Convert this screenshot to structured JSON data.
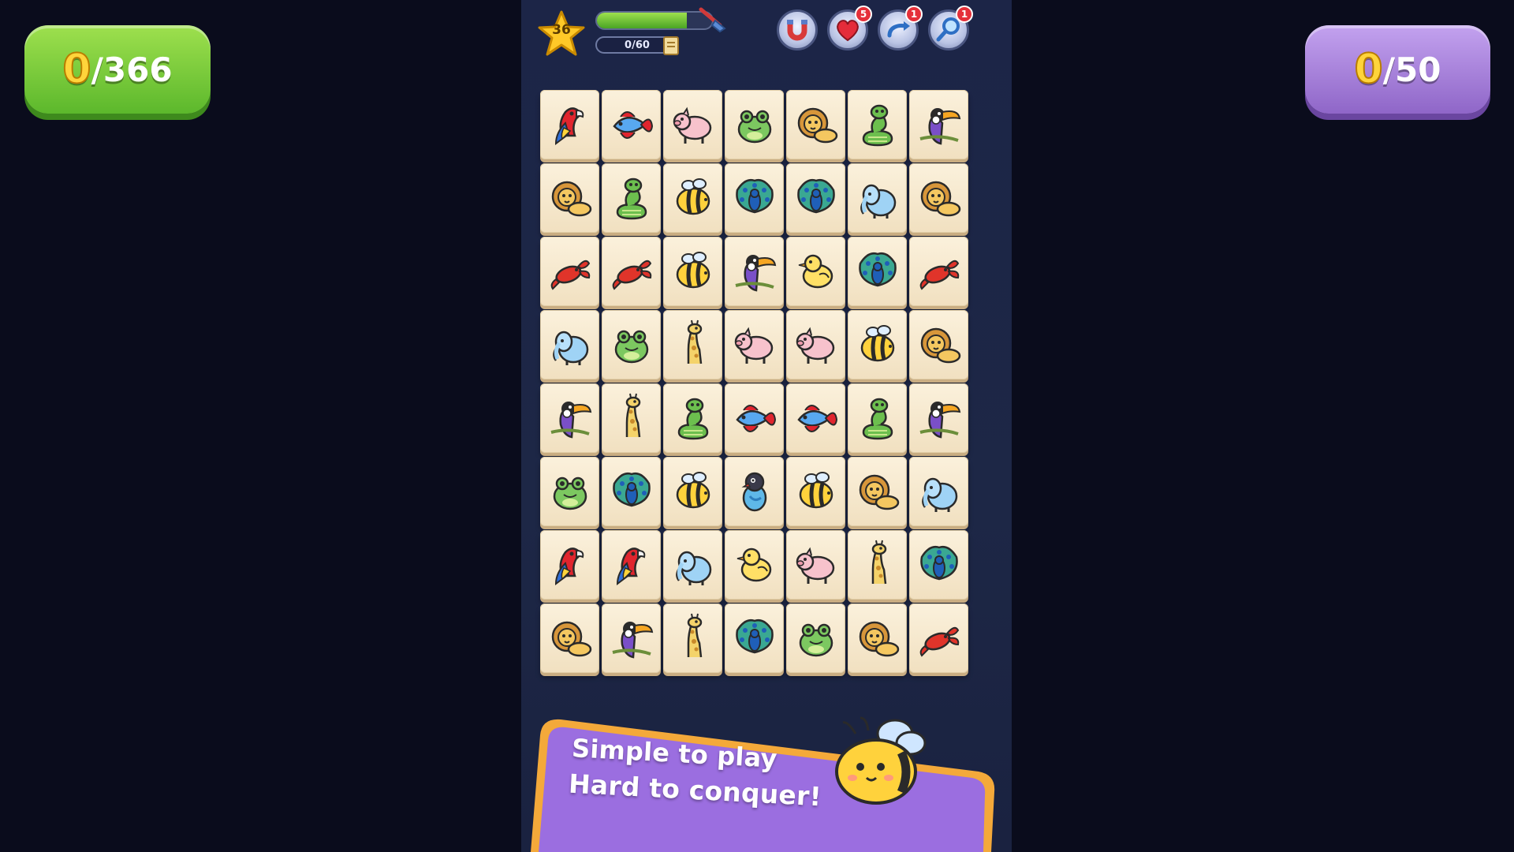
{
  "score_counter": {
    "current": "0",
    "total": "/366"
  },
  "goal_counter": {
    "current": "0",
    "total": "/50"
  },
  "hud": {
    "level": "36",
    "moves_text": "0/60",
    "progress": 0.78,
    "powerups": [
      {
        "name": "hint-powerup",
        "icon": "magnet-icon",
        "badge": ""
      },
      {
        "name": "life-powerup",
        "icon": "heart-icon",
        "badge": "5"
      },
      {
        "name": "shuffle-powerup",
        "icon": "shuffle-icon",
        "badge": "1"
      },
      {
        "name": "search-powerup",
        "icon": "magnifier-icon",
        "badge": "1"
      }
    ]
  },
  "board": {
    "columns": 7,
    "tiles": [
      "parrot",
      "fish",
      "pig",
      "frog",
      "lion",
      "snake",
      "toucan",
      "lion",
      "snake",
      "bee",
      "peacock",
      "peacock",
      "elephant",
      "lion",
      "lobster",
      "lobster",
      "bee",
      "toucan",
      "chick",
      "peacock",
      "lobster",
      "elephant",
      "frog",
      "giraffe",
      "pig",
      "pig",
      "bee",
      "lion",
      "toucan",
      "giraffe",
      "snake",
      "fish",
      "fish",
      "snake",
      "toucan",
      "frog",
      "peacock",
      "bee",
      "lovebird",
      "bee",
      "lion",
      "elephant",
      "parrot",
      "parrot",
      "elephant",
      "chick",
      "pig",
      "giraffe",
      "peacock",
      "lion",
      "toucan",
      "giraffe",
      "peacock",
      "frog",
      "lion",
      "lobster"
    ]
  },
  "banner": {
    "line1": "Simple to play",
    "line2": "Hard to conquer!"
  },
  "colors": {
    "board_bg": "#1c2547",
    "tile": "#fbf1dc",
    "banner_purple": "#9b6ee0",
    "banner_gold": "#f4a93a"
  }
}
